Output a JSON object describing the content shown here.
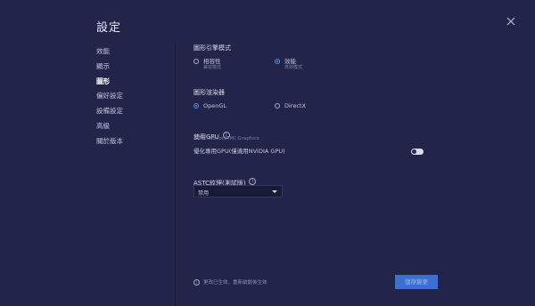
{
  "window": {
    "title": "設定"
  },
  "sidebar": {
    "items": [
      {
        "label": "效能"
      },
      {
        "label": "顯示"
      },
      {
        "label": "圖形"
      },
      {
        "label": "偏好設定"
      },
      {
        "label": "設備設定"
      },
      {
        "label": "高級"
      },
      {
        "label": "關於版本"
      }
    ],
    "active_index": 2
  },
  "graphics_engine": {
    "label": "圖形引擎模式",
    "options": [
      {
        "label": "相容性",
        "sub": "兼容模式",
        "selected": false
      },
      {
        "label": "效能",
        "sub": "高效模式",
        "selected": true
      }
    ]
  },
  "renderer": {
    "label": "圖形渲染器",
    "options": [
      {
        "label": "OpenGL",
        "selected": true
      },
      {
        "label": "DirectX",
        "selected": false
      }
    ]
  },
  "gpu": {
    "label": "使用GPU",
    "device": "AMD Radeon(TM) Graphics",
    "prefer_label": "優化專用GPU(僅適用NVIDIA GPU)",
    "prefer_enabled": false
  },
  "astc": {
    "label": "ASTC紋理(測試版)",
    "selected": "禁用"
  },
  "footer": {
    "note": "更改已生效，重新啟動後生效",
    "save_label": "儲存變更"
  },
  "colors": {
    "background": "#23244a",
    "accent": "#5c8cf0",
    "button": "#3c6fd0"
  },
  "icons": [
    "close-icon",
    "info-icon",
    "caret-down-icon"
  ]
}
